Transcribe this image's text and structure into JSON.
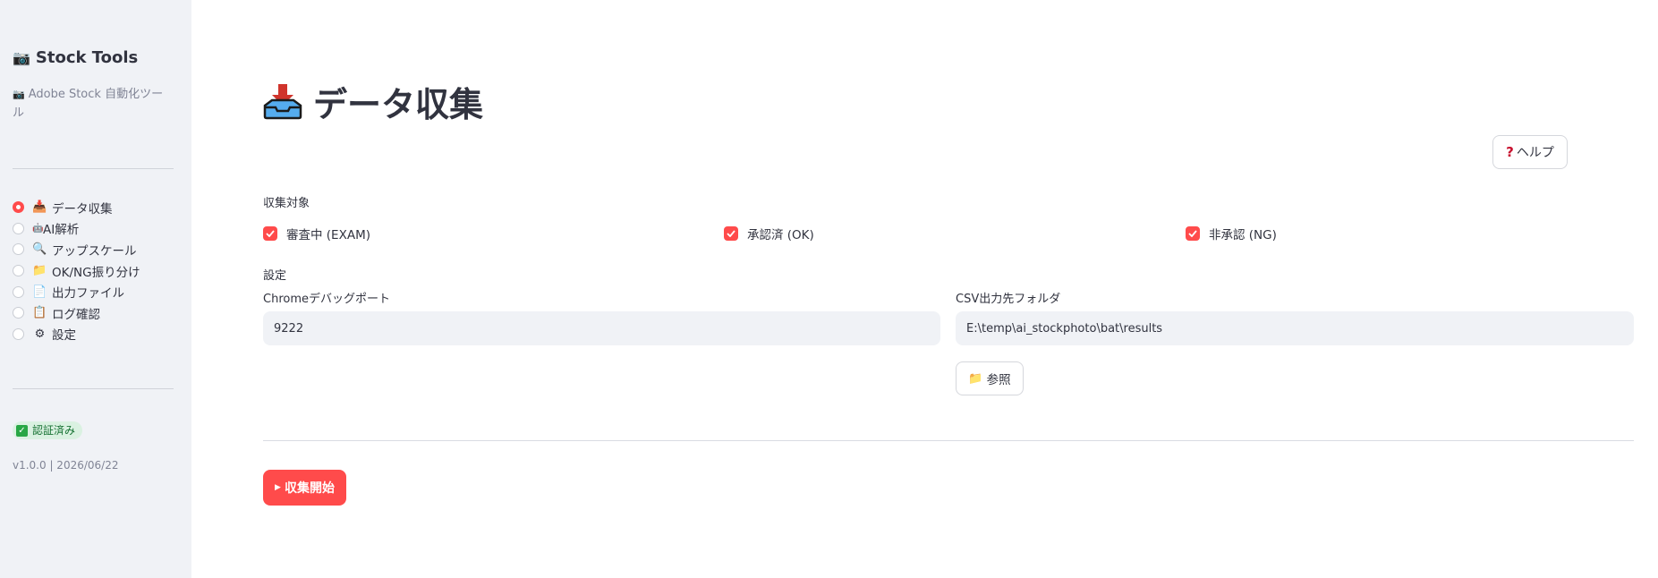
{
  "sidebar": {
    "title": "Stock Tools",
    "title_icon": "📷",
    "subtitle": "Adobe Stock 自動化ツール",
    "subtitle_icon": "📷",
    "nav": [
      {
        "label": "データ収集",
        "icon": "📥",
        "selected": true
      },
      {
        "label": "AI解析",
        "icon": "🤖",
        "selected": false
      },
      {
        "label": "アップスケール",
        "icon": "🔍",
        "selected": false
      },
      {
        "label": "OK/NG振り分け",
        "icon": "📁",
        "selected": false
      },
      {
        "label": "出力ファイル",
        "icon": "📄",
        "selected": false
      },
      {
        "label": "ログ確認",
        "icon": "📋",
        "selected": false
      },
      {
        "label": "設定",
        "icon": "⚙",
        "selected": false
      }
    ],
    "auth_badge": "認証済み",
    "version": "v1.0.0 | 2026/06/22"
  },
  "main": {
    "title": "データ収集",
    "help_label": "ヘルプ",
    "target_label": "収集対象",
    "checkboxes": [
      {
        "label": "審査中 (EXAM)",
        "checked": true
      },
      {
        "label": "承認済 (OK)",
        "checked": true
      },
      {
        "label": "非承認 (NG)",
        "checked": true
      }
    ],
    "settings_label": "設定",
    "port": {
      "label": "Chromeデバッグポート",
      "value": "9222"
    },
    "folder": {
      "label": "CSV出力先フォルダ",
      "value": "E:\\temp\\ai_stockphoto\\bat\\results"
    },
    "browse_label": "参照",
    "start_label": "収集開始"
  },
  "colors": {
    "accent": "#ff4b4b",
    "sidebar_bg": "#f0f2f6",
    "input_bg": "#f0f2f6",
    "auth_bg": "#daf1e1"
  }
}
